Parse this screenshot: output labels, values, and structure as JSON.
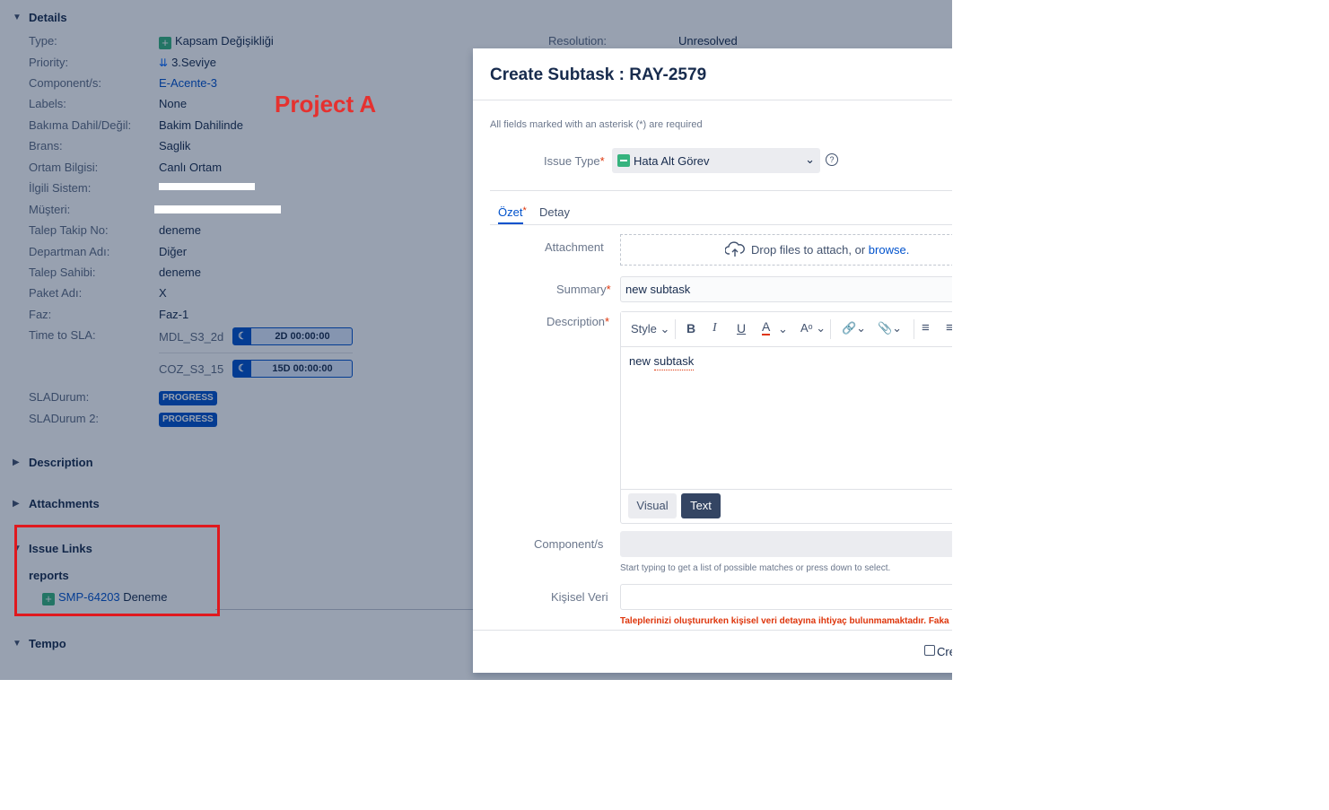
{
  "details": {
    "header": "Details",
    "rows": [
      {
        "label": "Type:",
        "value": "Kapsam Değişikliği"
      },
      {
        "label": "Priority:",
        "value": "3.Seviye"
      },
      {
        "label": "Component/s:",
        "value": "E-Acente-3"
      },
      {
        "label": "Labels:",
        "value": "None"
      },
      {
        "label": "Bakıma Dahil/Değil:",
        "value": "Bakim Dahilinde"
      },
      {
        "label": "Brans:",
        "value": "Saglik"
      },
      {
        "label": "Ortam Bilgisi:",
        "value": "Canlı Ortam"
      },
      {
        "label": "İlgili Sistem:",
        "value": ""
      },
      {
        "label": "Müşteri:",
        "value": ""
      },
      {
        "label": "Talep Takip No:",
        "value": "deneme"
      },
      {
        "label": "Departman Adı:",
        "value": "Diğer"
      },
      {
        "label": "Talep Sahibi:",
        "value": "deneme"
      },
      {
        "label": "Paket Adı:",
        "value": "X"
      },
      {
        "label": "Faz:",
        "value": "Faz-1"
      }
    ],
    "resolution_label": "Resolution:",
    "resolution_value": "Unresolved",
    "time_to_sla_label": "Time to SLA:",
    "sla": [
      {
        "name": "MDL_S3_2d",
        "time": "2D 00:00:00"
      },
      {
        "name": "COZ_S3_15",
        "time": "15D 00:00:00"
      }
    ],
    "sla_durum_label": "SLADurum:",
    "sla_durum_value": "PROGRESS",
    "sla_durum2_label": "SLADurum 2:",
    "sla_durum2_value": "PROGRESS"
  },
  "annotation": "Project A",
  "sections": {
    "description": "Description",
    "attachments": "Attachments",
    "issue_links": "Issue Links",
    "tempo": "Tempo"
  },
  "issue_links": {
    "relation": "reports",
    "key": "SMP-64203",
    "summary": "Deneme"
  },
  "dialog": {
    "title": "Create Subtask : RAY-2579",
    "required_note": "All fields marked with an asterisk (*) are required",
    "issue_type_label": "Issue Type",
    "issue_type_value": "Hata Alt Görev",
    "tabs": [
      "Özet",
      "Detay"
    ],
    "attachment_label": "Attachment",
    "attachment_drop": "Drop files to attach, or",
    "attachment_browse": "browse.",
    "summary_label": "Summary",
    "summary_value": "new subtask",
    "description_label": "Description",
    "toolbar_style": "Style",
    "description_value": "new subtask",
    "mode_visual": "Visual",
    "mode_text": "Text",
    "components_label": "Component/s",
    "components_hint": "Start typing to get a list of possible matches or press down to select.",
    "kisisel_label": "Kişisel Veri",
    "kisisel_warning": "Taleplerinizi oluştururken kişisel veri detayına ihtiyaç bulunmamaktadır. Faka",
    "create_another": "Cre"
  },
  "colors": {
    "overlay": "#091e42",
    "link": "#0052cc",
    "annotation_red": "#e5312f",
    "required_red": "#de350b",
    "add_icon_green": "#36b37e"
  }
}
